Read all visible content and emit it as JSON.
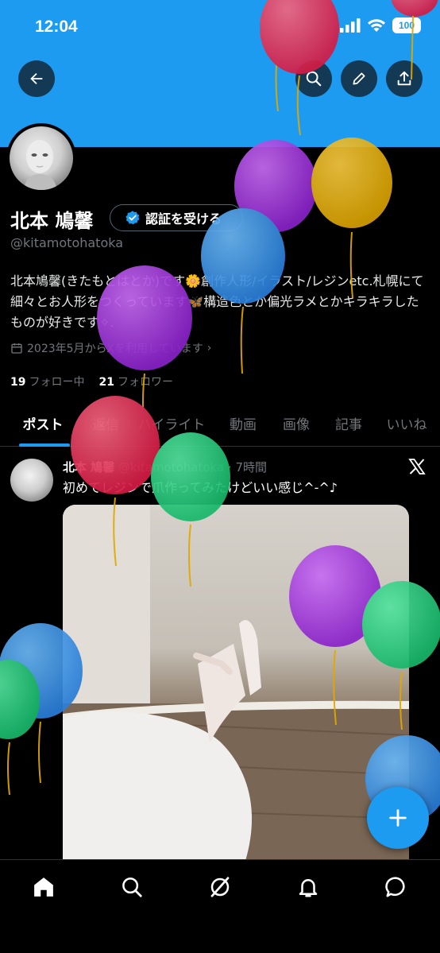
{
  "status_bar": {
    "time": "12:04",
    "battery": "100"
  },
  "profile": {
    "display_name": "北本 鳩馨",
    "verify_label": "認証を受ける",
    "handle": "@kitamotohatoka",
    "bio": "北本鳩馨(きたもとはとか)です🌼創作人形/イラスト/レジンetc.札幌にて細々とお人形をつくっています🦋構造色とか偏光ラメとかキラキラしたものが好きです✧.",
    "joined": "2023年5月からXを利用しています",
    "following_count": "19",
    "following_label": "フォロー中",
    "followers_count": "21",
    "followers_label": "フォロワー"
  },
  "tabs": [
    "ポスト",
    "返信",
    "ハイライト",
    "動画",
    "画像",
    "記事",
    "いいね"
  ],
  "post": {
    "author": "北本 鳩馨",
    "handle": "@kitamotohatoka",
    "time": "· 7時間",
    "text": "初めてレジンで爪作ってみたけどいい感じ^-^♪"
  },
  "icons": {
    "back": "arrow-left-icon",
    "search": "search-icon",
    "edit": "pencil-icon",
    "share": "share-icon",
    "verified": "verified-badge-icon",
    "calendar": "calendar-icon",
    "x_logo": "x-logo-icon",
    "home": "home-icon",
    "explore": "search-icon",
    "grok": "grok-icon",
    "notifications": "bell-icon",
    "messages": "message-icon",
    "compose": "plus-icon"
  },
  "colors": {
    "accent": "#1d9bf0",
    "background": "#000000",
    "text": "#e7e9ea",
    "muted": "#71767b"
  }
}
